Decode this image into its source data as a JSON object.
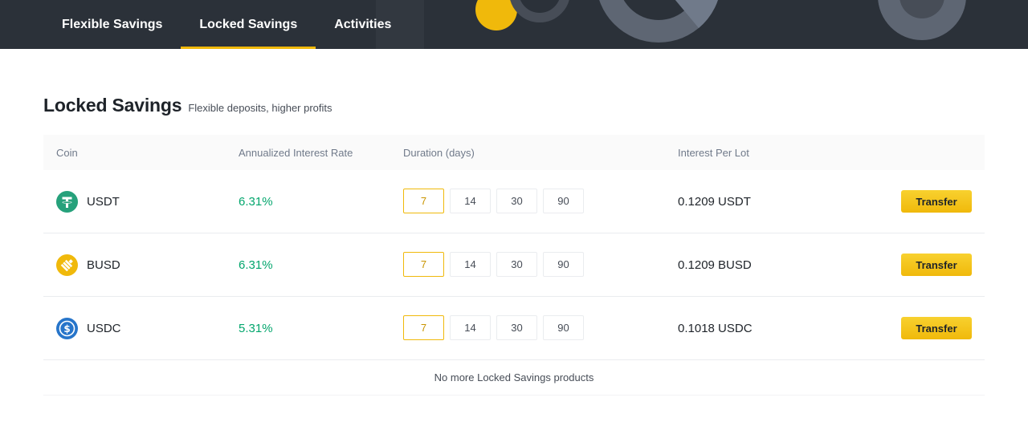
{
  "nav": {
    "tabs": [
      {
        "label": "Flexible Savings",
        "active": false
      },
      {
        "label": "Locked Savings",
        "active": true
      },
      {
        "label": "Activities",
        "active": false
      }
    ]
  },
  "heading": {
    "title": "Locked Savings",
    "subtitle": "Flexible deposits, higher profits"
  },
  "table": {
    "headers": {
      "coin": "Coin",
      "rate": "Annualized Interest Rate",
      "duration": "Duration (days)",
      "lot": "Interest Per Lot"
    },
    "rows": [
      {
        "coin": "USDT",
        "icon": "tether-icon",
        "rate": "6.31%",
        "durations": [
          "7",
          "14",
          "30",
          "90"
        ],
        "selected_duration": "7",
        "interest_per_lot": "0.1209 USDT",
        "action": "Transfer"
      },
      {
        "coin": "BUSD",
        "icon": "busd-icon",
        "rate": "6.31%",
        "durations": [
          "7",
          "14",
          "30",
          "90"
        ],
        "selected_duration": "7",
        "interest_per_lot": "0.1209 BUSD",
        "action": "Transfer"
      },
      {
        "coin": "USDC",
        "icon": "usdc-icon",
        "rate": "5.31%",
        "durations": [
          "7",
          "14",
          "30",
          "90"
        ],
        "selected_duration": "7",
        "interest_per_lot": "0.1018 USDC",
        "action": "Transfer"
      }
    ],
    "footer": "No more Locked Savings products"
  },
  "colors": {
    "accent": "#f0b90b",
    "positive": "#03a66d",
    "topbar": "#2b3139",
    "tether": "#26a17b",
    "busd": "#f0b90b",
    "usdc": "#2775ca"
  }
}
